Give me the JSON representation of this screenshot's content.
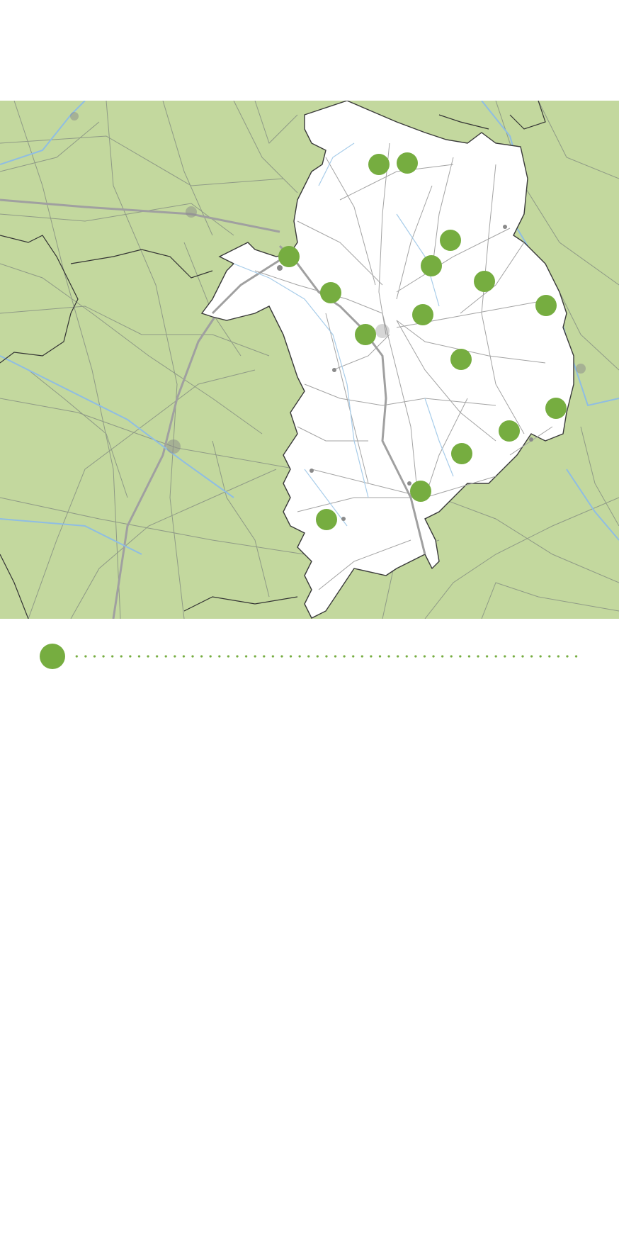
{
  "map": {
    "colors": {
      "outside_land": "#c3d89e",
      "department": "#ffffff",
      "roads": "#9a9a9a",
      "major_roads": "#a8a8a8",
      "rivers": "#9fc6e6",
      "borders": "#3a3a3a",
      "marker": "#76ad40"
    },
    "markers": [
      {
        "id": "marker-1"
      },
      {
        "id": "marker-2"
      },
      {
        "id": "marker-3"
      },
      {
        "id": "marker-4"
      },
      {
        "id": "marker-5"
      },
      {
        "id": "marker-6"
      },
      {
        "id": "marker-7"
      },
      {
        "id": "marker-8"
      },
      {
        "id": "marker-9"
      },
      {
        "id": "marker-10"
      },
      {
        "id": "marker-11"
      },
      {
        "id": "marker-12"
      },
      {
        "id": "marker-13"
      },
      {
        "id": "marker-14"
      },
      {
        "id": "marker-15"
      },
      {
        "id": "marker-16"
      },
      {
        "id": "marker-17"
      }
    ]
  },
  "legend": {
    "marker_color": "#76ad40",
    "label": ""
  }
}
